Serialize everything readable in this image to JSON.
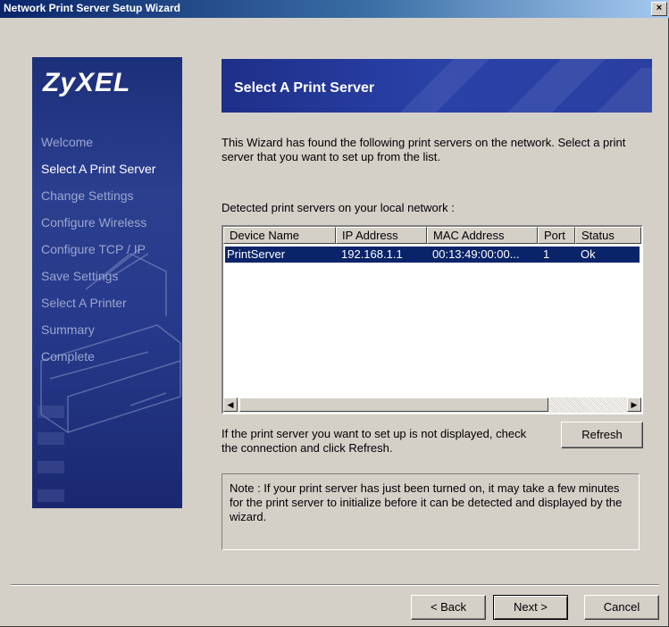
{
  "window": {
    "title": "Network Print Server Setup Wizard",
    "close_glyph": "×"
  },
  "banner": {
    "logo": "ZyXEL",
    "steps": [
      {
        "label": "Welcome"
      },
      {
        "label": "Select A Print Server"
      },
      {
        "label": "Change Settings"
      },
      {
        "label": "Configure Wireless"
      },
      {
        "label": "Configure TCP / IP"
      },
      {
        "label": "Save Settings"
      },
      {
        "label": "Select A Printer"
      },
      {
        "label": "Summary"
      },
      {
        "label": "Complete"
      }
    ],
    "active_step_index": 1
  },
  "header": {
    "title": "Select A Print Server"
  },
  "intro": {
    "text": "This Wizard has found the following print servers on the network. Select a print server that you want to set up from the list."
  },
  "detected": {
    "label": "Detected print servers on your local network :"
  },
  "server_list": {
    "columns": [
      "Device Name",
      "IP Address",
      "MAC Address",
      "Port",
      "Status"
    ],
    "rows": [
      {
        "device_name": "PrintServer",
        "ip_address": "192.168.1.1",
        "mac_address": "00:13:49:00:00...",
        "port": "1",
        "status": "Ok"
      }
    ],
    "selected_row": 0,
    "scroll_left_glyph": "◀",
    "scroll_right_glyph": "▶"
  },
  "refresh": {
    "hint": "If the print server you want to set up is not displayed, check the connection and click Refresh.",
    "button_label": "Refresh"
  },
  "note": {
    "text": "Note : If your print server has just been turned on, it may take a few minutes for the print server to initialize before it can be detected and displayed by the wizard."
  },
  "footer": {
    "back_label": "< Back",
    "next_label": "Next >",
    "cancel_label": "Cancel"
  },
  "colors": {
    "selection": "#0a246a",
    "dialog_face": "#d4d0c8",
    "banner_blue": "#26398a"
  }
}
